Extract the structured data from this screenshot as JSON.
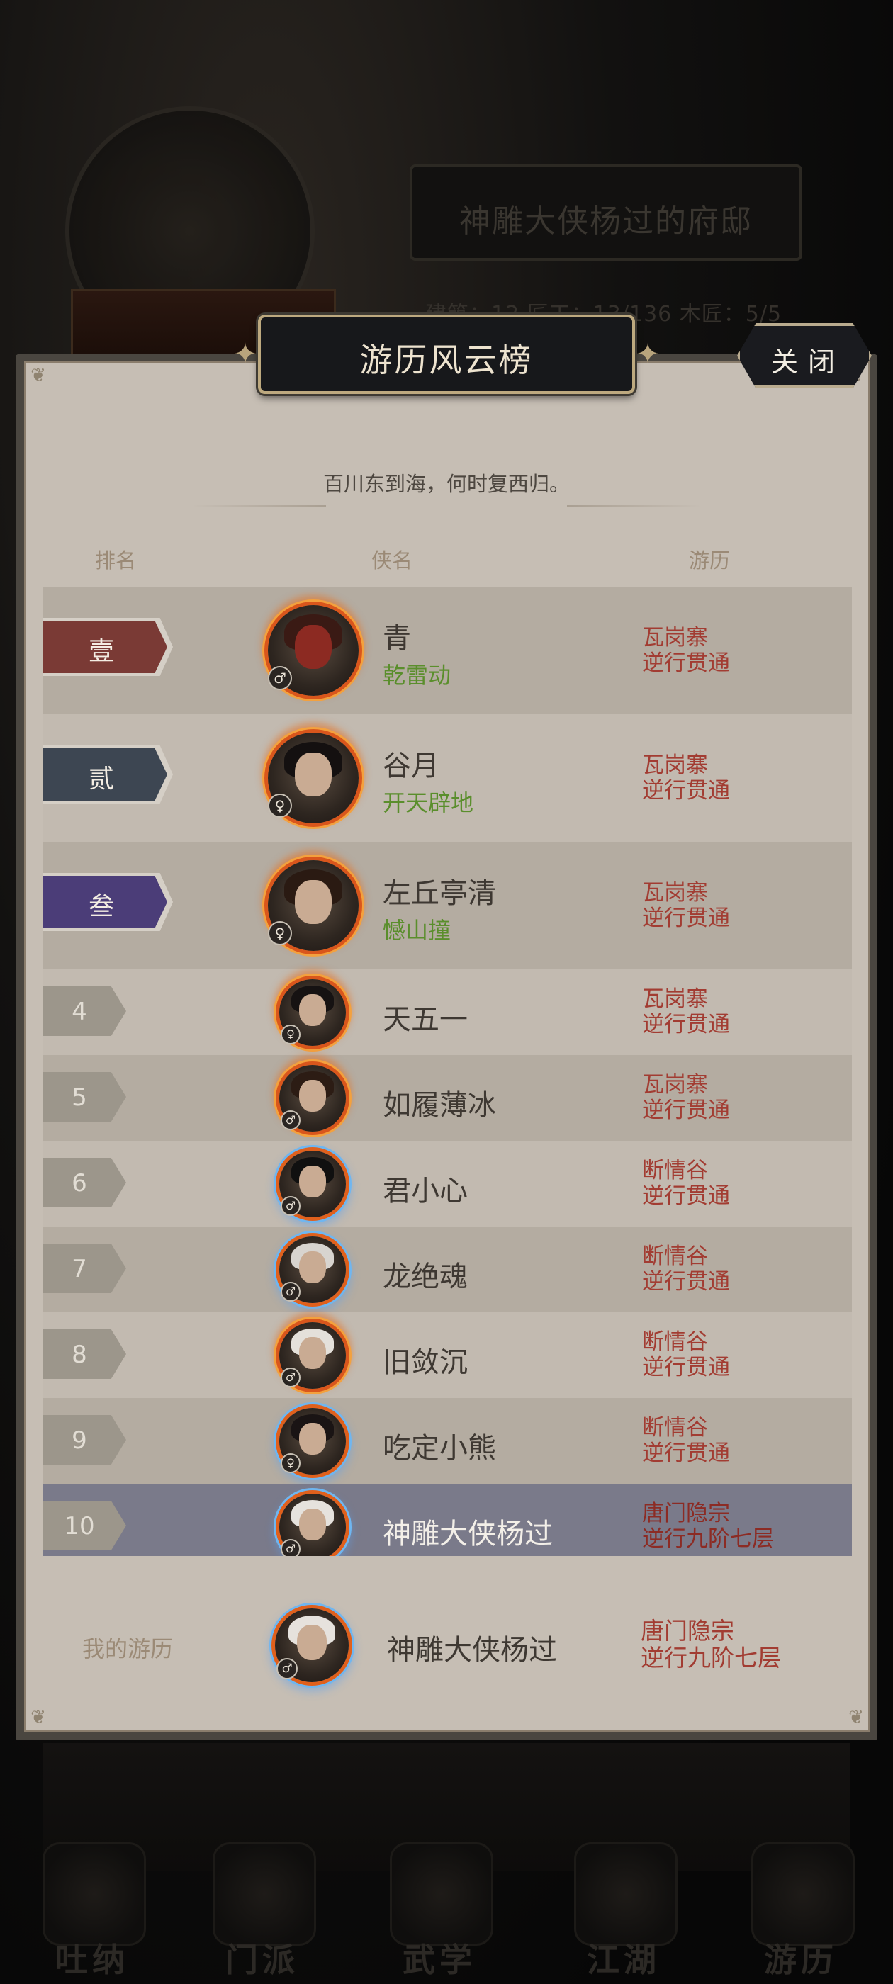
{
  "background": {
    "residence_title": "神雕大侠杨过的府邸",
    "stats_text": "建筑：12    匠工：13/136    木匠：5/5",
    "nav": [
      {
        "label": "吐纳",
        "icon": "meditate-icon"
      },
      {
        "label": "门派",
        "icon": "sect-icon"
      },
      {
        "label": "武学",
        "icon": "martial-book-icon"
      },
      {
        "label": "江湖",
        "icon": "world-icon"
      },
      {
        "label": "游历",
        "icon": "travel-icon"
      }
    ]
  },
  "modal": {
    "title": "游历风云榜",
    "close_label": "关闭",
    "subtitle": "百川东到海，何时复西归。",
    "columns": {
      "rank": "排名",
      "name": "侠名",
      "journey": "游历"
    }
  },
  "colors": {
    "rank1": "#7a3a35",
    "rank2": "#3d4652",
    "rank3": "#4b3d78",
    "journey_text": "#a23c32",
    "skill_text": "#5a8e2c"
  },
  "leaderboard": [
    {
      "rank": "壹",
      "name": "青",
      "title": "乾雷动",
      "gender": "♂",
      "journey_line1": "瓦岗寨",
      "journey_line2": "逆行贯通"
    },
    {
      "rank": "贰",
      "name": "谷月",
      "title": "开天辟地",
      "gender": "♀",
      "journey_line1": "瓦岗寨",
      "journey_line2": "逆行贯通"
    },
    {
      "rank": "叁",
      "name": "左丘亭清",
      "title": "憾山撞",
      "gender": "♀",
      "journey_line1": "瓦岗寨",
      "journey_line2": "逆行贯通"
    },
    {
      "rank": "4",
      "name": "天五一",
      "gender": "♀",
      "journey_line1": "瓦岗寨",
      "journey_line2": "逆行贯通"
    },
    {
      "rank": "5",
      "name": "如履薄冰",
      "gender": "♂",
      "journey_line1": "瓦岗寨",
      "journey_line2": "逆行贯通"
    },
    {
      "rank": "6",
      "name": "君小心",
      "gender": "♂",
      "journey_line1": "断情谷",
      "journey_line2": "逆行贯通"
    },
    {
      "rank": "7",
      "name": "龙绝魂",
      "gender": "♂",
      "journey_line1": "断情谷",
      "journey_line2": "逆行贯通"
    },
    {
      "rank": "8",
      "name": "旧敛沉",
      "gender": "♂",
      "journey_line1": "断情谷",
      "journey_line2": "逆行贯通"
    },
    {
      "rank": "9",
      "name": "吃定小熊",
      "gender": "♀",
      "journey_line1": "断情谷",
      "journey_line2": "逆行贯通"
    },
    {
      "rank": "10",
      "name": "神雕大侠杨过",
      "gender": "♂",
      "journey_line1": "唐门隐宗",
      "journey_line2": "逆行九阶七层"
    }
  ],
  "my_journey": {
    "label": "我的游历",
    "name": "神雕大侠杨过",
    "gender": "♂",
    "journey_line1": "唐门隐宗",
    "journey_line2": "逆行九阶七层"
  }
}
